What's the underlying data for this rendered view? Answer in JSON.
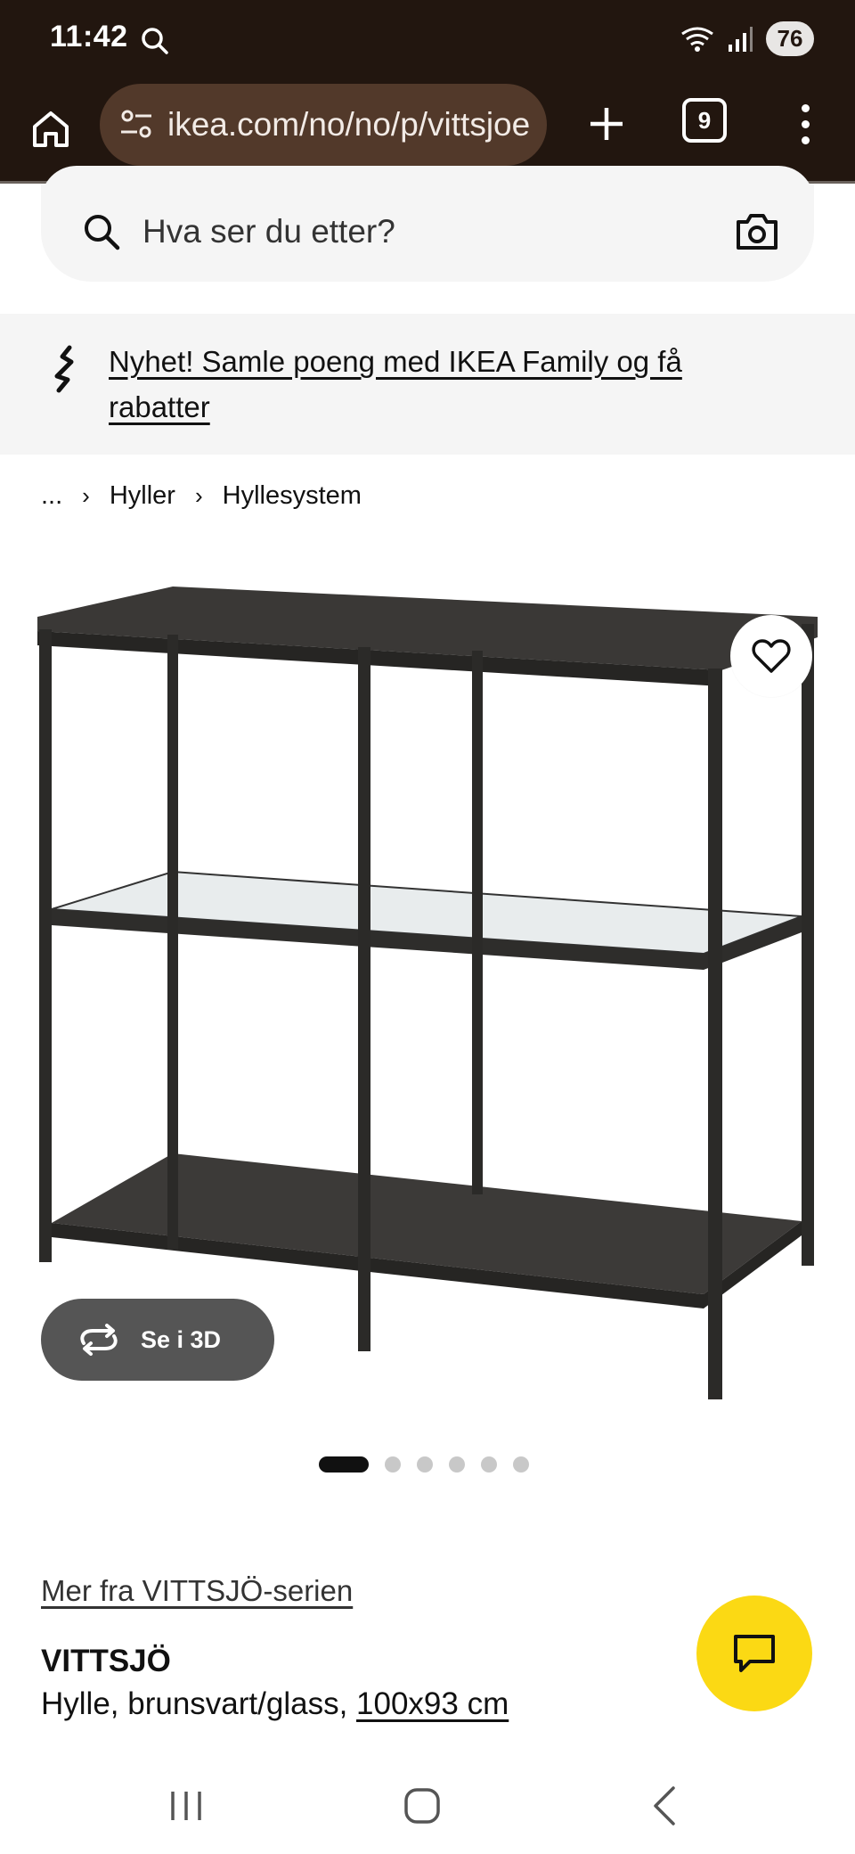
{
  "status_bar": {
    "time": "11:42",
    "battery": "76"
  },
  "browser": {
    "url": "ikea.com/no/no/p/vittsjoe",
    "tab_count": "9"
  },
  "search": {
    "placeholder": "Hva ser du etter?"
  },
  "promo": {
    "text": "Nyhet! Samle poeng med IKEA Family og få rabatter"
  },
  "breadcrumb": {
    "ellipsis": "...",
    "items": [
      "Hyller",
      "Hyllesystem"
    ]
  },
  "gallery": {
    "view_3d_label": "Se i 3D",
    "image_count": 6,
    "active_index": 0
  },
  "product": {
    "series_link": "Mer fra VITTSJÖ-serien",
    "name": "VITTSJÖ",
    "description": "Hylle, brunsvart/glass, ",
    "size": "100x93 cm"
  },
  "colors": {
    "header_bg": "#22160f",
    "url_pill_bg": "#52392a",
    "chat_fab": "#fbd914",
    "panel_bg": "#f5f5f5"
  },
  "icons": {
    "status": [
      "search-icon",
      "wifi-icon",
      "signal-icon"
    ],
    "browser": [
      "home-icon",
      "site-settings-icon",
      "plus-icon",
      "tabs-icon",
      "more-vert-icon"
    ],
    "search": [
      "search-icon",
      "camera-icon"
    ],
    "misc": [
      "ikea-family-icon",
      "heart-icon",
      "rotate-3d-icon",
      "chat-icon"
    ]
  }
}
